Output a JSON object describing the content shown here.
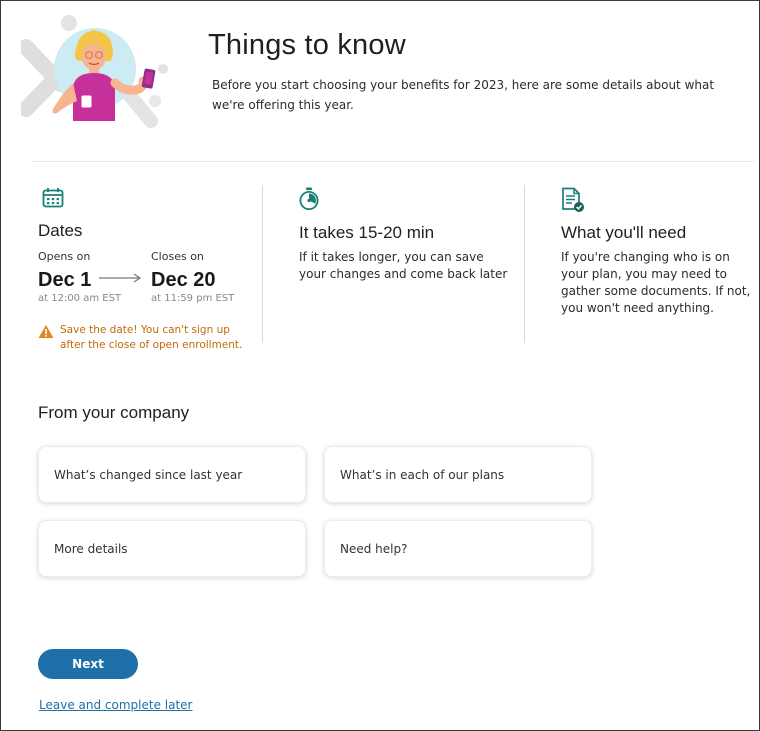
{
  "header": {
    "title": "Things to know",
    "intro": "Before you start choosing your benefits for 2023, here are some details about what we're offering this year."
  },
  "dates": {
    "icon": "calendar-icon",
    "title": "Dates",
    "opens_label": "Opens on",
    "opens_date": "Dec 1",
    "opens_time": "at 12:00 am EST",
    "closes_label": "Closes on",
    "closes_date": "Dec 20",
    "closes_time": "at 11:59 pm EST",
    "warning": "Save the date! You can't sign up after the close of open enrollment."
  },
  "duration": {
    "icon": "stopwatch-icon",
    "title": "It takes 15-20 min",
    "body": "If it takes longer, you can save your changes and come back later"
  },
  "needs": {
    "icon": "document-check-icon",
    "title": "What you'll need",
    "body": "If you're changing who is on your plan, you may need to gather some documents. If not, you won't need anything."
  },
  "company": {
    "title": "From your company",
    "cards": [
      {
        "label": "What’s changed since last year"
      },
      {
        "label": "What’s in each of our plans"
      },
      {
        "label": "More details"
      },
      {
        "label": "Need help?"
      }
    ]
  },
  "actions": {
    "next_label": "Next",
    "leave_label": "Leave and complete later"
  },
  "colors": {
    "accent": "#1f6fa8",
    "warning": "#c26a0a",
    "teal_icon": "#1a7f74",
    "illustration_pink": "#c7309b"
  }
}
